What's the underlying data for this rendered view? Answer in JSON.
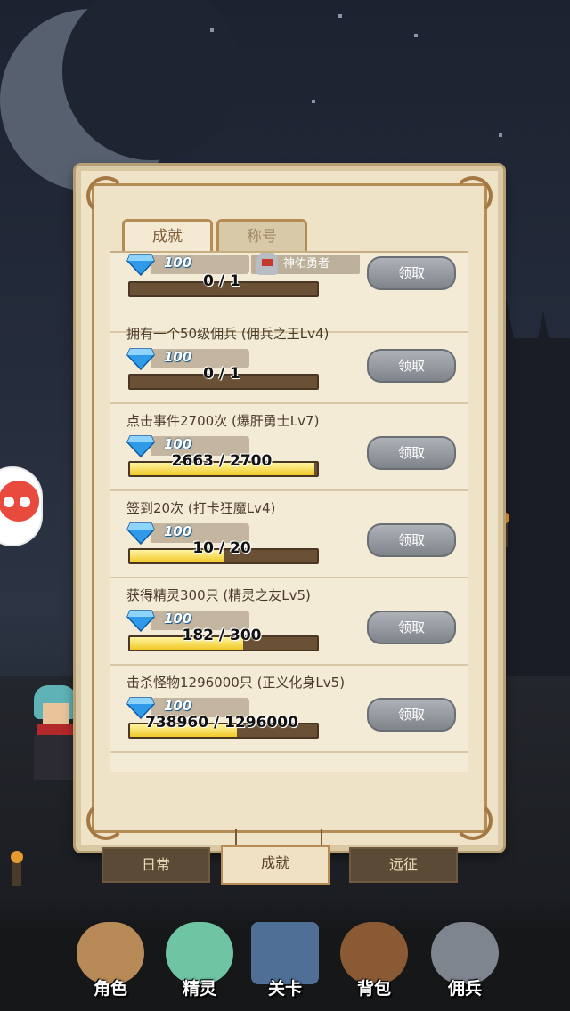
{
  "tabs": [
    {
      "label": "成就",
      "active": true
    },
    {
      "label": "称号",
      "active": false
    }
  ],
  "achievements": [
    {
      "title": "",
      "reward_amount": "100",
      "reward_title": "神佑勇者",
      "progress_text": "0 / 1",
      "progress": 0.0,
      "claim_label": "领取"
    },
    {
      "title": "拥有一个50级佣兵   (佣兵之王Lv4)",
      "reward_amount": "100",
      "progress_text": "0 / 1",
      "progress": 0.0,
      "claim_label": "领取"
    },
    {
      "title": "点击事件2700次   (爆肝勇士Lv7)",
      "reward_amount": "100",
      "progress_text": "2663 / 2700",
      "progress": 0.986,
      "claim_label": "领取"
    },
    {
      "title": "签到20次   (打卡狂魔Lv4)",
      "reward_amount": "100",
      "progress_text": "10 / 20",
      "progress": 0.5,
      "claim_label": "领取"
    },
    {
      "title": "获得精灵300只   (精灵之友Lv5)",
      "reward_amount": "100",
      "progress_text": "182 / 300",
      "progress": 0.607,
      "claim_label": "领取"
    },
    {
      "title": "击杀怪物1296000只   (正义化身Lv5)",
      "reward_amount": "100",
      "progress_text": "738960 / 1296000",
      "progress": 0.57,
      "claim_label": "领取"
    }
  ],
  "sub_tabs": [
    {
      "label": "日常",
      "active": false
    },
    {
      "label": "成就",
      "active": true
    },
    {
      "label": "远征",
      "active": false
    }
  ],
  "bottom_nav": [
    {
      "label": "角色",
      "icon": "character-icon"
    },
    {
      "label": "精灵",
      "icon": "spirit-icon"
    },
    {
      "label": "关卡",
      "icon": "stage-icon"
    },
    {
      "label": "背包",
      "icon": "backpack-icon"
    },
    {
      "label": "佣兵",
      "icon": "mercenary-icon"
    }
  ],
  "colors": {
    "parchment": "#eee2c7",
    "progress_fill": "#f1c928",
    "gem": "#2f9be8",
    "claim_button": "#9a9ea5"
  }
}
